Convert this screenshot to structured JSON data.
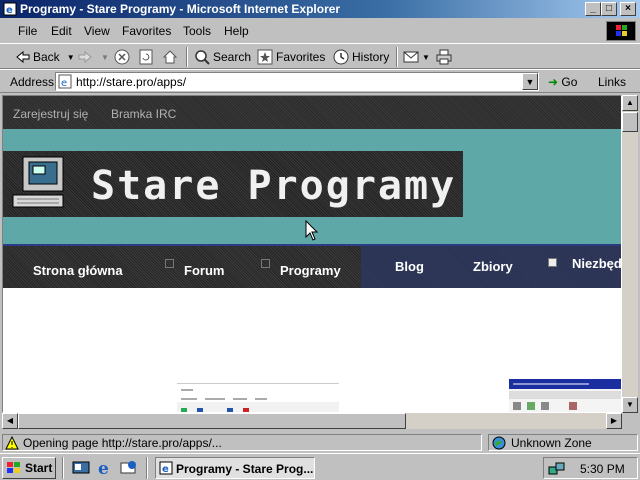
{
  "window": {
    "title": "Programy - Stare Programy - Microsoft Internet Explorer",
    "controls": {
      "minimize": "_",
      "maximize": "□",
      "close": "×"
    }
  },
  "menu": [
    "File",
    "Edit",
    "View",
    "Favorites",
    "Tools",
    "Help"
  ],
  "toolbar": {
    "back": "Back",
    "search": "Search",
    "favorites": "Favorites",
    "history": "History"
  },
  "address": {
    "label": "Address",
    "url": "http://stare.pro/apps/",
    "go": "Go",
    "links": "Links"
  },
  "page": {
    "top_links": [
      "Zarejestruj się",
      "Bramka IRC"
    ],
    "logo_text": "Stare Programy",
    "nav": [
      "Strona główna",
      "Forum",
      "Programy",
      "Blog",
      "Zbiory",
      "Niezbęd"
    ]
  },
  "status": {
    "text": "Opening page http://stare.pro/apps/...",
    "zone": "Unknown Zone"
  },
  "taskbar": {
    "start": "Start",
    "task": "Programy - Stare Prog...",
    "clock": "5:30 PM"
  },
  "colors": {
    "title_active": "#0a246a",
    "banner_teal": "#5fa8a8",
    "nav_blue": "#2b3a78"
  }
}
